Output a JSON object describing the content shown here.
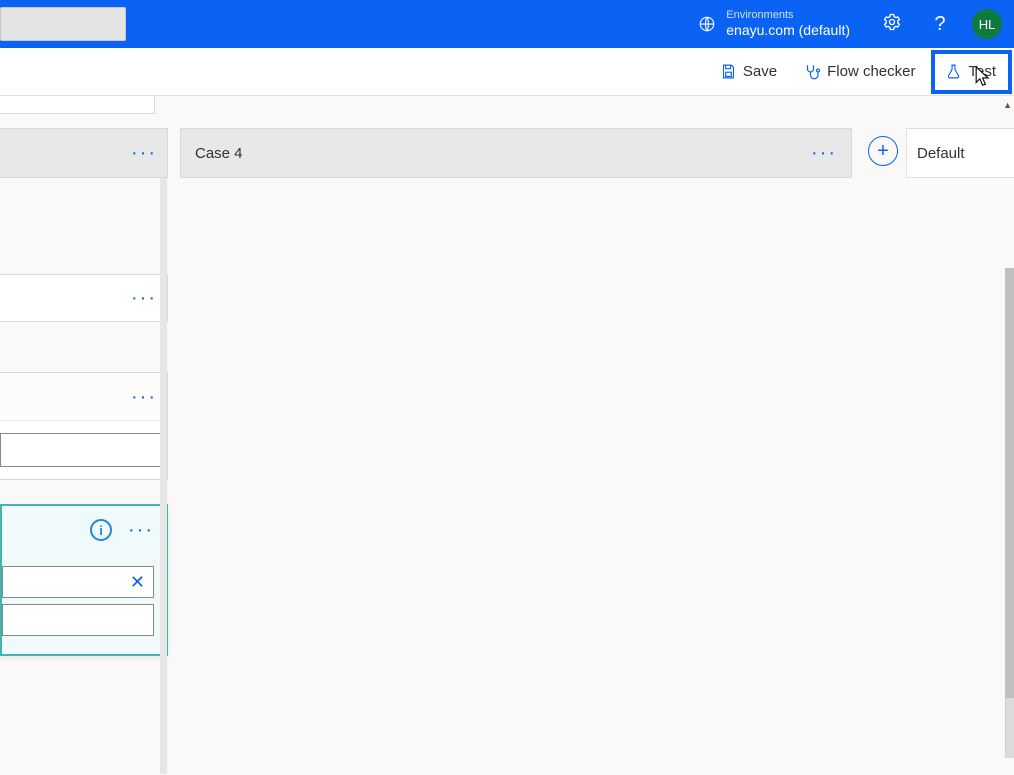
{
  "header": {
    "environments_label": "Environments",
    "environment_name": "enayu.com (default)",
    "avatar_initials": "HL"
  },
  "toolbar": {
    "save_label": "Save",
    "flow_checker_label": "Flow checker",
    "test_label": "Test",
    "test_tooltip": "Test"
  },
  "canvas": {
    "case4_label": "Case 4",
    "default_label": "Default"
  }
}
